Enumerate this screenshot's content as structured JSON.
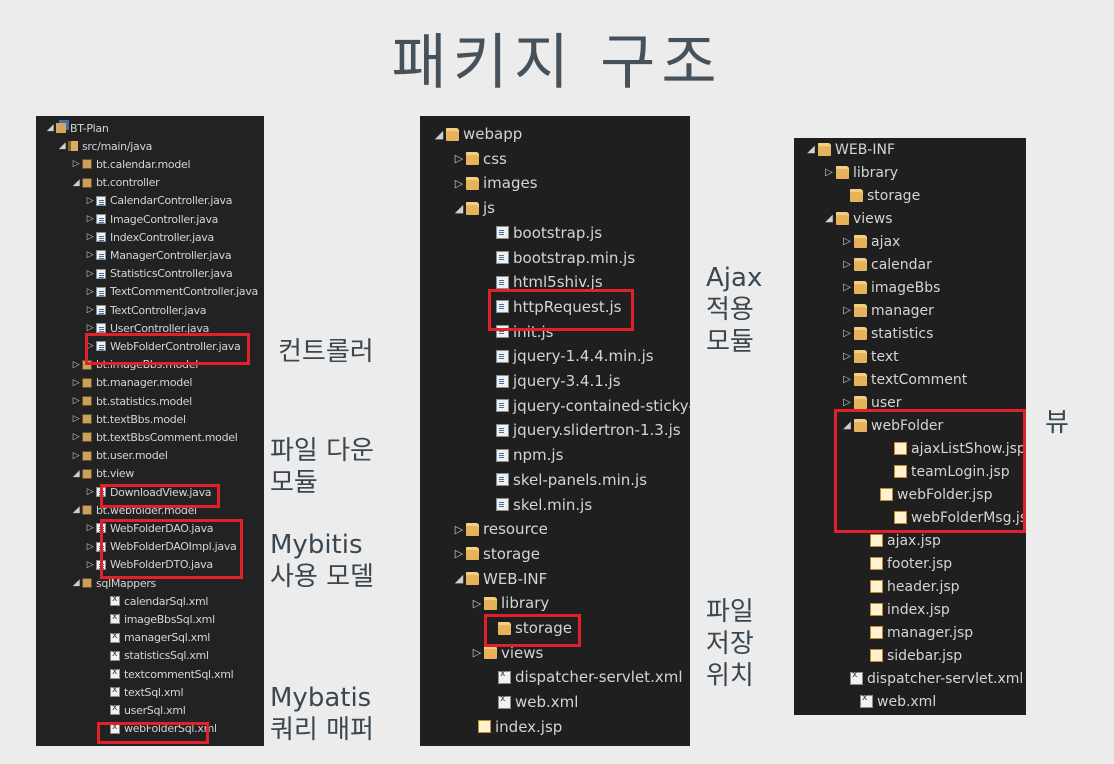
{
  "title": "패키지 구조",
  "colors": {
    "highlight": "#e0202a",
    "panel_bg": "#1f1f1f",
    "title": "#45515b"
  },
  "panel1": {
    "items": [
      {
        "label": "BT-Plan",
        "icon": "project-icon",
        "arrow": "◢"
      },
      {
        "label": "src/main/java",
        "icon": "source-folder-icon",
        "arrow": "◢"
      },
      {
        "label": "bt.calendar.model",
        "icon": "package-icon",
        "arrow": "▷"
      },
      {
        "label": "bt.controller",
        "icon": "package-icon",
        "arrow": "◢"
      },
      {
        "label": "CalendarController.java",
        "icon": "java-file-icon",
        "arrow": "▷"
      },
      {
        "label": "ImageController.java",
        "icon": "java-file-icon",
        "arrow": "▷"
      },
      {
        "label": "IndexController.java",
        "icon": "java-file-icon",
        "arrow": "▷"
      },
      {
        "label": "ManagerController.java",
        "icon": "java-file-icon",
        "arrow": "▷"
      },
      {
        "label": "StatisticsController.java",
        "icon": "java-file-icon",
        "arrow": "▷"
      },
      {
        "label": "TextCommentController.java",
        "icon": "java-file-icon",
        "arrow": "▷"
      },
      {
        "label": "TextController.java",
        "icon": "java-file-icon",
        "arrow": "▷"
      },
      {
        "label": "UserController.java",
        "icon": "java-file-icon",
        "arrow": "▷"
      },
      {
        "label": "WebFolderController.java",
        "icon": "java-file-icon",
        "arrow": "▷"
      },
      {
        "label": "bt.imageBbs.model",
        "icon": "package-icon",
        "arrow": "▷"
      },
      {
        "label": "bt.manager.model",
        "icon": "package-icon",
        "arrow": "▷"
      },
      {
        "label": "bt.statistics.model",
        "icon": "package-icon",
        "arrow": "▷"
      },
      {
        "label": "bt.textBbs.model",
        "icon": "package-icon",
        "arrow": "▷"
      },
      {
        "label": "bt.textBbsComment.model",
        "icon": "package-icon",
        "arrow": "▷"
      },
      {
        "label": "bt.user.model",
        "icon": "package-icon",
        "arrow": "▷"
      },
      {
        "label": "bt.view",
        "icon": "package-icon",
        "arrow": "◢"
      },
      {
        "label": "DownloadView.java",
        "icon": "java-file-icon",
        "arrow": "▷"
      },
      {
        "label": "bt.webfolder.model",
        "icon": "package-icon",
        "arrow": "◢"
      },
      {
        "label": "WebFolderDAO.java",
        "icon": "java-file-icon",
        "arrow": "▷"
      },
      {
        "label": "WebFolderDAOImpl.java",
        "icon": "java-file-icon",
        "arrow": "▷"
      },
      {
        "label": "WebFolderDTO.java",
        "icon": "java-file-icon",
        "arrow": "▷"
      },
      {
        "label": "sqlMappers",
        "icon": "package-icon",
        "arrow": "◢"
      },
      {
        "label": "calendarSql.xml",
        "icon": "xml-file-icon",
        "arrow": ""
      },
      {
        "label": "imageBbsSql.xml",
        "icon": "xml-file-icon",
        "arrow": ""
      },
      {
        "label": "managerSql.xml",
        "icon": "xml-file-icon",
        "arrow": ""
      },
      {
        "label": "statisticsSql.xml",
        "icon": "xml-file-icon",
        "arrow": ""
      },
      {
        "label": "textcommentSql.xml",
        "icon": "xml-file-icon",
        "arrow": ""
      },
      {
        "label": "textSql.xml",
        "icon": "xml-file-icon",
        "arrow": ""
      },
      {
        "label": "userSql.xml",
        "icon": "xml-file-icon",
        "arrow": ""
      },
      {
        "label": "webFolderSql.xml",
        "icon": "xml-file-icon",
        "arrow": ""
      }
    ]
  },
  "panel2": {
    "items": [
      {
        "label": "webapp",
        "icon": "folder-icon",
        "arrow": "◢"
      },
      {
        "label": "css",
        "icon": "folder-icon",
        "arrow": "▷"
      },
      {
        "label": "images",
        "icon": "folder-icon",
        "arrow": "▷"
      },
      {
        "label": "js",
        "icon": "folder-icon",
        "arrow": "◢"
      },
      {
        "label": "bootstrap.js",
        "icon": "js-file-icon",
        "arrow": ""
      },
      {
        "label": "bootstrap.min.js",
        "icon": "js-file-icon",
        "arrow": ""
      },
      {
        "label": "html5shiv.js",
        "icon": "js-file-icon",
        "arrow": ""
      },
      {
        "label": "httpRequest.js",
        "icon": "js-file-icon",
        "arrow": ""
      },
      {
        "label": "init.js",
        "icon": "js-file-icon",
        "arrow": ""
      },
      {
        "label": "jquery-1.4.4.min.js",
        "icon": "js-file-icon",
        "arrow": ""
      },
      {
        "label": "jquery-3.4.1.js",
        "icon": "js-file-icon",
        "arrow": ""
      },
      {
        "label": "jquery-contained-sticky-",
        "icon": "js-file-icon",
        "arrow": ""
      },
      {
        "label": "jquery.slidertron-1.3.js",
        "icon": "js-file-icon",
        "arrow": ""
      },
      {
        "label": "npm.js",
        "icon": "js-file-icon",
        "arrow": ""
      },
      {
        "label": "skel-panels.min.js",
        "icon": "js-file-icon",
        "arrow": ""
      },
      {
        "label": "skel.min.js",
        "icon": "js-file-icon",
        "arrow": ""
      },
      {
        "label": "resource",
        "icon": "folder-icon",
        "arrow": "▷"
      },
      {
        "label": "storage",
        "icon": "folder-icon",
        "arrow": "▷"
      },
      {
        "label": "WEB-INF",
        "icon": "folder-icon",
        "arrow": "◢"
      },
      {
        "label": "library",
        "icon": "folder-icon",
        "arrow": "▷"
      },
      {
        "label": "storage",
        "icon": "folder-icon",
        "arrow": ""
      },
      {
        "label": "views",
        "icon": "folder-icon",
        "arrow": "▷"
      },
      {
        "label": "dispatcher-servlet.xml",
        "icon": "xml-file-icon",
        "arrow": ""
      },
      {
        "label": "web.xml",
        "icon": "xml-file-icon",
        "arrow": ""
      },
      {
        "label": "index.jsp",
        "icon": "jsp-file-icon",
        "arrow": ""
      }
    ]
  },
  "panel3": {
    "items": [
      {
        "label": "WEB-INF",
        "icon": "folder-icon",
        "arrow": "◢"
      },
      {
        "label": "library",
        "icon": "folder-icon",
        "arrow": "▷"
      },
      {
        "label": "storage",
        "icon": "folder-icon",
        "arrow": ""
      },
      {
        "label": "views",
        "icon": "folder-icon",
        "arrow": "◢"
      },
      {
        "label": "ajax",
        "icon": "folder-icon",
        "arrow": "▷"
      },
      {
        "label": "calendar",
        "icon": "folder-icon",
        "arrow": "▷"
      },
      {
        "label": "imageBbs",
        "icon": "folder-icon",
        "arrow": "▷"
      },
      {
        "label": "manager",
        "icon": "folder-icon",
        "arrow": "▷"
      },
      {
        "label": "statistics",
        "icon": "folder-icon",
        "arrow": "▷"
      },
      {
        "label": "text",
        "icon": "folder-icon",
        "arrow": "▷"
      },
      {
        "label": "textComment",
        "icon": "folder-icon",
        "arrow": "▷"
      },
      {
        "label": "user",
        "icon": "folder-icon",
        "arrow": "▷"
      },
      {
        "label": "webFolder",
        "icon": "folder-icon",
        "arrow": "◢"
      },
      {
        "label": "ajaxListShow.jsp",
        "icon": "jsp-file-icon",
        "arrow": ""
      },
      {
        "label": "teamLogin.jsp",
        "icon": "jsp-file-icon",
        "arrow": ""
      },
      {
        "label": "webFolder.jsp",
        "icon": "jsp-file-icon",
        "arrow": ""
      },
      {
        "label": "webFolderMsg.jsp",
        "icon": "jsp-file-icon",
        "arrow": ""
      },
      {
        "label": "ajax.jsp",
        "icon": "jsp-file-icon",
        "arrow": ""
      },
      {
        "label": "footer.jsp",
        "icon": "jsp-file-icon",
        "arrow": ""
      },
      {
        "label": "header.jsp",
        "icon": "jsp-file-icon",
        "arrow": ""
      },
      {
        "label": "index.jsp",
        "icon": "jsp-file-icon",
        "arrow": ""
      },
      {
        "label": "manager.jsp",
        "icon": "jsp-file-icon",
        "arrow": ""
      },
      {
        "label": "sidebar.jsp",
        "icon": "jsp-file-icon",
        "arrow": ""
      },
      {
        "label": "dispatcher-servlet.xml",
        "icon": "xml-file-icon",
        "arrow": ""
      },
      {
        "label": "web.xml",
        "icon": "xml-file-icon",
        "arrow": ""
      }
    ]
  },
  "callouts": {
    "controller": "컨트롤러",
    "file_download_1": "파일 다운",
    "file_download_2": "모듈",
    "mybatis_model_1": "Mybitis",
    "mybatis_model_2": "사용 모델",
    "mybatis_mapper_1": "Mybatis",
    "mybatis_mapper_2": "쿼리 매퍼",
    "ajax_1": "Ajax",
    "ajax_2": "적용",
    "ajax_3": "모듈",
    "storage_1": "파일",
    "storage_2": "저장",
    "storage_3": "위치",
    "view": "뷰"
  }
}
